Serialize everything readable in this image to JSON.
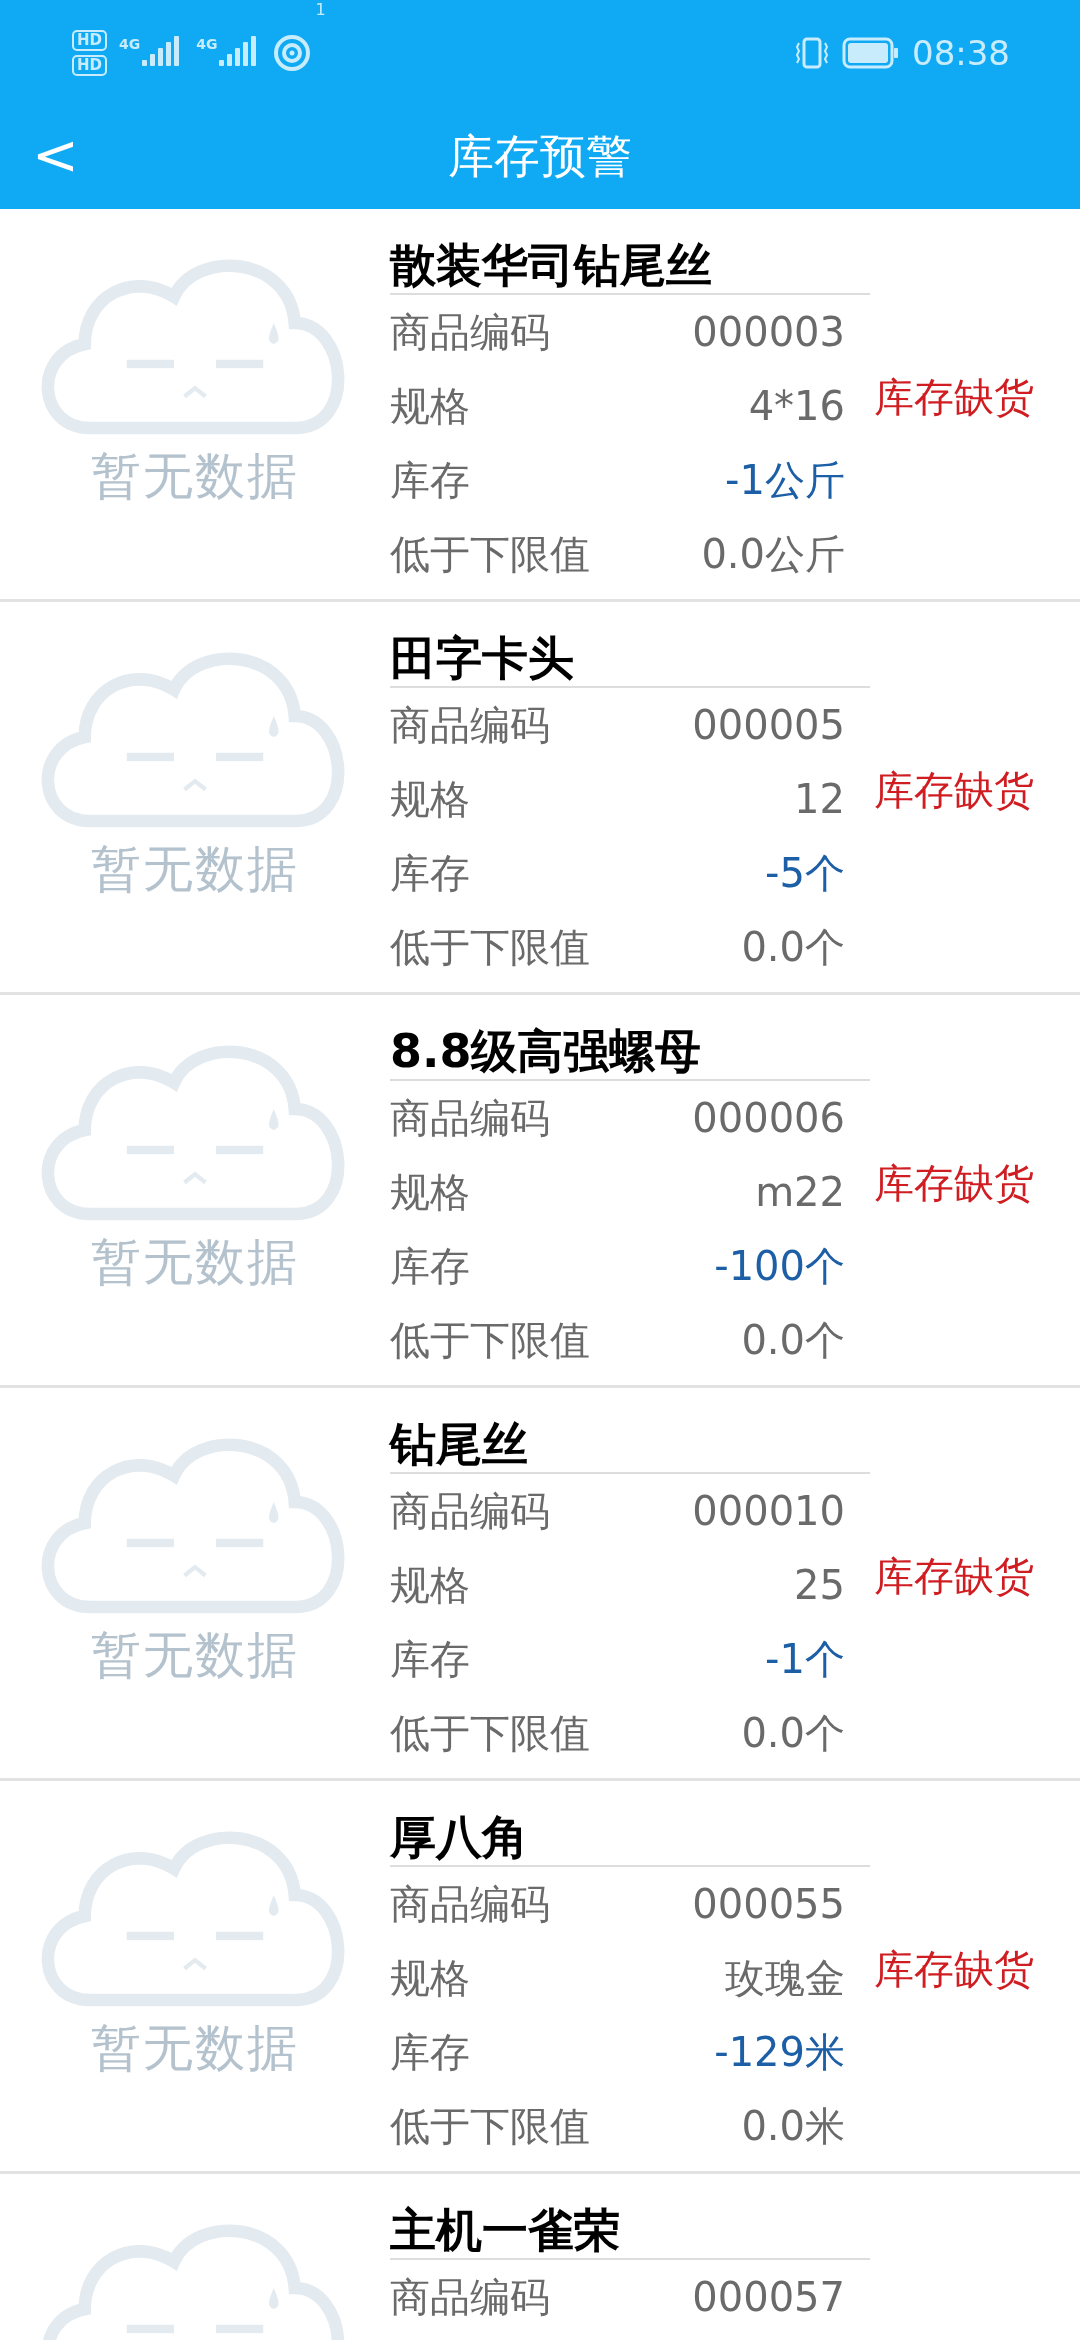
{
  "status_bar": {
    "sim_badges": [
      "HD",
      "HD"
    ],
    "networks": [
      "4G",
      "4G"
    ],
    "hotspot_count": "1",
    "time": "08:38"
  },
  "header": {
    "back": "<",
    "title": "库存预警"
  },
  "items": [
    {
      "image_text": "暂无数据",
      "name": "散装华司钻尾丝",
      "fields": [
        {
          "label": "商品编码",
          "value": "000003",
          "kind": "plain"
        },
        {
          "label": "规格",
          "value": "4*16",
          "kind": "plain"
        },
        {
          "label": "库存",
          "value": "-1公斤",
          "kind": "stock"
        },
        {
          "label": "低于下限值",
          "value": "0.0公斤",
          "kind": "plain"
        }
      ],
      "status": "库存缺货"
    },
    {
      "image_text": "暂无数据",
      "name": "田字卡头",
      "fields": [
        {
          "label": "商品编码",
          "value": "000005",
          "kind": "plain"
        },
        {
          "label": "规格",
          "value": "12",
          "kind": "plain"
        },
        {
          "label": "库存",
          "value": "-5个",
          "kind": "stock"
        },
        {
          "label": "低于下限值",
          "value": "0.0个",
          "kind": "plain"
        }
      ],
      "status": "库存缺货"
    },
    {
      "image_text": "暂无数据",
      "name": "8.8级高强螺母",
      "fields": [
        {
          "label": "商品编码",
          "value": "000006",
          "kind": "plain"
        },
        {
          "label": "规格",
          "value": "m22",
          "kind": "plain"
        },
        {
          "label": "库存",
          "value": "-100个",
          "kind": "stock"
        },
        {
          "label": "低于下限值",
          "value": "0.0个",
          "kind": "plain"
        }
      ],
      "status": "库存缺货"
    },
    {
      "image_text": "暂无数据",
      "name": "钻尾丝",
      "fields": [
        {
          "label": "商品编码",
          "value": "000010",
          "kind": "plain"
        },
        {
          "label": "规格",
          "value": "25",
          "kind": "plain"
        },
        {
          "label": "库存",
          "value": "-1个",
          "kind": "stock"
        },
        {
          "label": "低于下限值",
          "value": "0.0个",
          "kind": "plain"
        }
      ],
      "status": "库存缺货"
    },
    {
      "image_text": "暂无数据",
      "name": "厚八角",
      "fields": [
        {
          "label": "商品编码",
          "value": "000055",
          "kind": "plain"
        },
        {
          "label": "规格",
          "value": "玫瑰金",
          "kind": "plain"
        },
        {
          "label": "库存",
          "value": "-129米",
          "kind": "stock"
        },
        {
          "label": "低于下限值",
          "value": "0.0米",
          "kind": "plain"
        }
      ],
      "status": "库存缺货"
    },
    {
      "name": "主机一雀荣",
      "fields": [
        {
          "label": "商品编码",
          "value": "000057",
          "kind": "plain"
        }
      ]
    }
  ]
}
